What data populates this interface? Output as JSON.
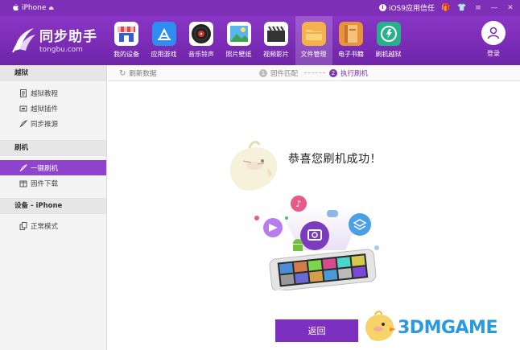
{
  "titlebar": {
    "device_label": "iPhone",
    "trust_label": "iOS9应用信任"
  },
  "header": {
    "logo_cn": "同步助手",
    "logo_en": "tongbu.com",
    "tools": [
      {
        "label": "我的设备",
        "icon": "store-icon",
        "color": "#3b5bd6"
      },
      {
        "label": "应用游戏",
        "icon": "app-store-icon",
        "color": "#2f8cf0"
      },
      {
        "label": "音乐铃声",
        "icon": "vinyl-record-icon",
        "color": "#222222"
      },
      {
        "label": "照片壁纸",
        "icon": "photo-icon",
        "color": "#3e9be0"
      },
      {
        "label": "视频影片",
        "icon": "clapperboard-icon",
        "color": "#333333"
      },
      {
        "label": "文件管理",
        "icon": "folder-icon",
        "color": "#f2a13b"
      },
      {
        "label": "电子书籍",
        "icon": "book-icon",
        "color": "#d9822b"
      },
      {
        "label": "刷机越狱",
        "icon": "flash-icon",
        "color": "#27b089"
      }
    ],
    "login_label": "登录"
  },
  "sidebar": {
    "sections": [
      {
        "title": "越狱",
        "items": [
          {
            "label": "越狱教程",
            "icon": "document-icon"
          },
          {
            "label": "越狱插件",
            "icon": "plugin-icon"
          },
          {
            "label": "同步推源",
            "icon": "feather-icon"
          }
        ]
      },
      {
        "title": "刷机",
        "items": [
          {
            "label": "一键刷机",
            "icon": "feather-icon"
          },
          {
            "label": "固件下载",
            "icon": "package-icon"
          }
        ]
      },
      {
        "title": "设备 - iPhone",
        "items": [
          {
            "label": "正常模式",
            "icon": "copy-icon"
          }
        ]
      }
    ]
  },
  "main": {
    "refresh_label": "刷新数据",
    "steps": [
      {
        "num": "1",
        "label": "固件匹配"
      },
      {
        "num": "2",
        "label": "执行刷机"
      }
    ],
    "success_text": "恭喜您刷机成功！",
    "back_label": "返回"
  },
  "watermark": {
    "text": "3DMGAME"
  },
  "colors": {
    "brand": "#7e2fb7",
    "active": "#8e44cc",
    "button": "#7d2fbf"
  }
}
